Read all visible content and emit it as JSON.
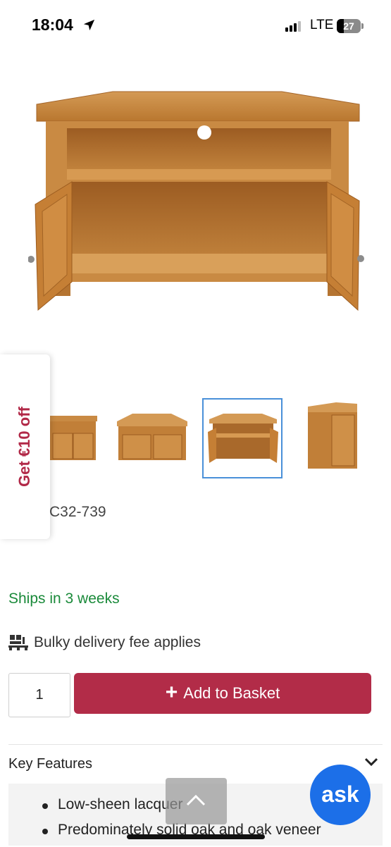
{
  "status_bar": {
    "time": "18:04",
    "network": "LTE",
    "battery": "27"
  },
  "product": {
    "main_image_icon": "corner-tv-cabinet-doors-open",
    "thumbnails": [
      {
        "icon": "tv-cabinet-front",
        "selected": false
      },
      {
        "icon": "corner-tv-cabinet-closed",
        "selected": false
      },
      {
        "icon": "corner-tv-cabinet-open",
        "selected": true
      },
      {
        "icon": "corner-tv-cabinet-side",
        "selected": false
      }
    ],
    "sku": "C32-739",
    "availability": "Ships in 3 weeks",
    "delivery_note": "Bulky delivery fee applies"
  },
  "promo": {
    "label": "Get €10 off"
  },
  "purchase": {
    "quantity": "1",
    "add_label": "Add to Basket"
  },
  "key_features": {
    "title": "Key Features",
    "items": [
      "Low-sheen lacquer",
      "Predominately solid oak and oak veneer"
    ]
  },
  "chat": {
    "label": "ask"
  },
  "colors": {
    "accent": "#b22c48",
    "success": "#1a8a3a",
    "chat": "#1c6fe8"
  }
}
